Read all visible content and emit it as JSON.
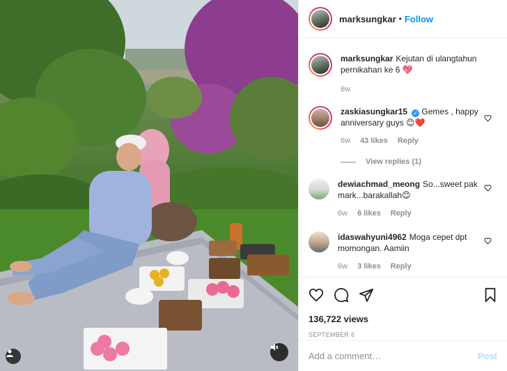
{
  "post": {
    "author": "marksungkar",
    "follow_label": "Follow",
    "separator": "•",
    "caption": {
      "user": "marksungkar",
      "text": "Kejutan di ulangtahun pernikahan ke 6 💖",
      "time": "6w"
    },
    "comments": [
      {
        "user": "zaskiasungkar15",
        "verified": true,
        "text": "Gemes , happy anniversary guys 😊❤️",
        "time": "6w",
        "likes": "43 likes",
        "reply": "Reply",
        "view_replies": "View replies (1)"
      },
      {
        "user": "dewiachmad_meong",
        "verified": false,
        "text": "So...sweet pak mark...barakallah😊",
        "time": "6w",
        "likes": "6 likes",
        "reply": "Reply"
      },
      {
        "user": "idaswahyuni4962",
        "verified": false,
        "text": "Moga cepet dpt momongan. Aamiin",
        "time": "6w",
        "likes": "3 likes",
        "reply": "Reply"
      }
    ],
    "views": "136,722 views",
    "date": "SEPTEMBER 6",
    "add_comment_placeholder": "Add a comment…",
    "post_label": "Post"
  },
  "colors": {
    "accent": "#0095f6",
    "post_disabled": "#b2dffc",
    "muted": "#8e8e8e",
    "verified": "#3897f0"
  },
  "icons": [
    "heart-icon",
    "comment-icon",
    "share-icon",
    "bookmark-icon",
    "mute-icon",
    "user-tag-icon",
    "verified-icon"
  ]
}
